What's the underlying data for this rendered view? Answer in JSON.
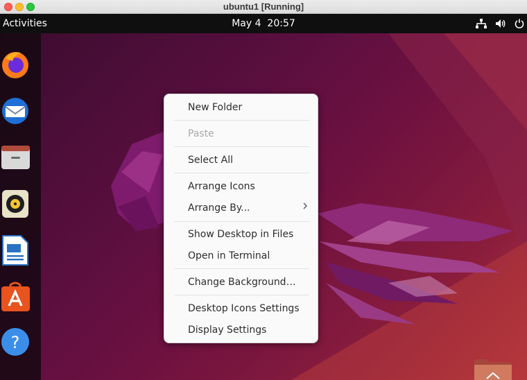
{
  "window": {
    "title": "ubuntu1 [Running]"
  },
  "topbar": {
    "activities": "Activities",
    "date": "May 4",
    "time": "20:57",
    "tray_icons": [
      "network-icon",
      "volume-icon",
      "power-icon"
    ]
  },
  "dock": {
    "apps": [
      "firefox",
      "thunderbird",
      "files",
      "rhythmbox",
      "libreoffice-writer",
      "ubuntu-software",
      "help"
    ]
  },
  "context_menu": {
    "new_folder": "New Folder",
    "paste": "Paste",
    "select_all": "Select All",
    "arrange_icons": "Arrange Icons",
    "arrange_by": "Arrange By...",
    "show_in_files": "Show Desktop in Files",
    "open_terminal": "Open in Terminal",
    "change_background": "Change Background…",
    "icons_settings": "Desktop Icons Settings",
    "display_settings": "Display Settings"
  },
  "colors": {
    "topbar": "#0f0f0f",
    "menu_bg": "#fafafa",
    "desktop_purple": "#5a0f3f",
    "desktop_red": "#b8343a"
  }
}
